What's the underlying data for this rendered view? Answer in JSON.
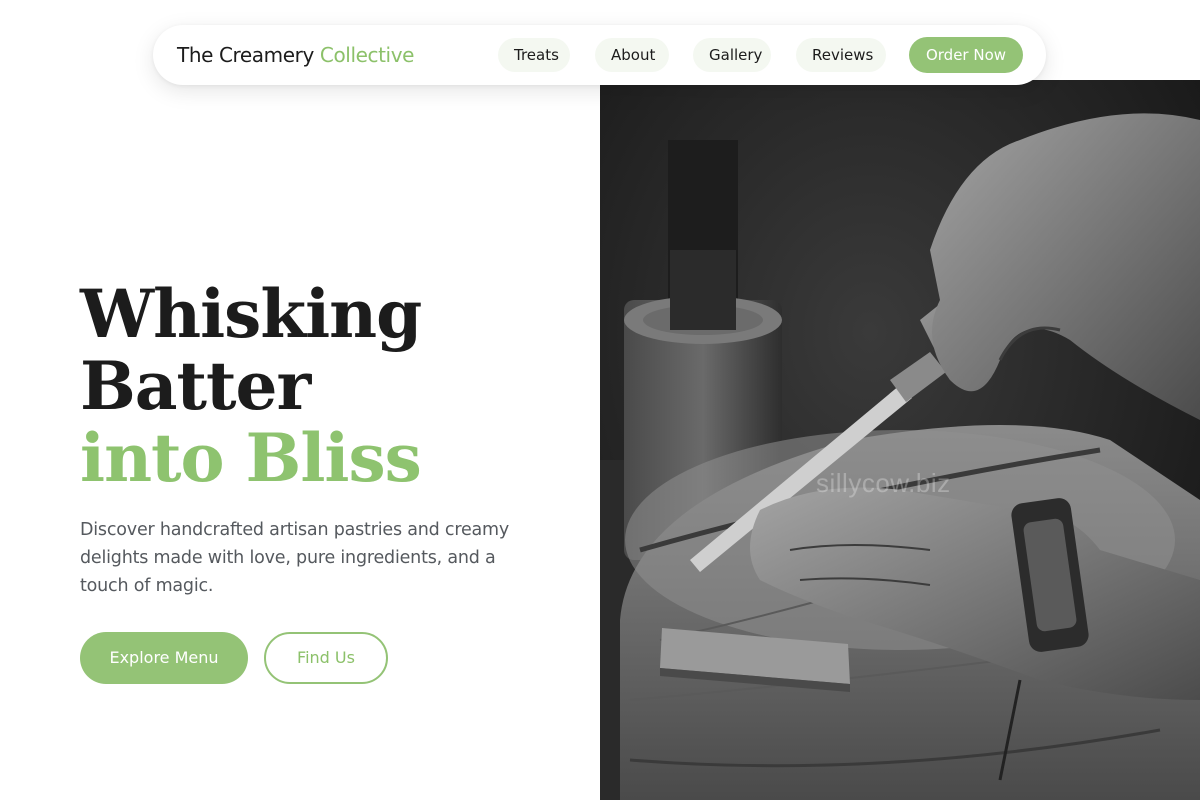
{
  "brand": {
    "name_part1": "The Creamery",
    "name_part2": "Collective"
  },
  "nav": {
    "links": [
      {
        "label": "Treats"
      },
      {
        "label": "About"
      },
      {
        "label": "Gallery"
      },
      {
        "label": "Reviews"
      }
    ],
    "cta_label": "Order Now"
  },
  "hero": {
    "title_line1": "Whisking",
    "title_line2": "Batter",
    "title_line3": "into Bliss",
    "description": "Discover handcrafted artisan pastries and creamy delights made with love, pure ingredients, and a touch of magic.",
    "primary_button": "Explore Menu",
    "secondary_button": "Find Us"
  },
  "photo": {
    "watermark": "sillycow.biz"
  },
  "colors": {
    "accent": "#94c376",
    "text": "#1c1c1c",
    "muted": "#55595e"
  }
}
